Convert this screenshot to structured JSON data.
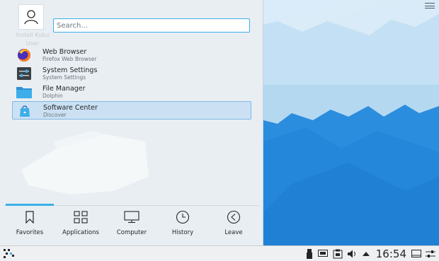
{
  "launcher": {
    "user": {
      "line1": "Install Kubu",
      "line2": "User"
    },
    "search": {
      "placeholder": "Search..."
    },
    "apps": [
      {
        "name": "Web Browser",
        "description": "Firefox Web Browser",
        "icon": "firefox-icon"
      },
      {
        "name": "System Settings",
        "description": "System Settings",
        "icon": "system-settings-icon"
      },
      {
        "name": "File Manager",
        "description": "Dolphin",
        "icon": "folder-icon"
      },
      {
        "name": "Software Center",
        "description": "Discover",
        "icon": "discover-icon",
        "selected": true
      }
    ],
    "tabs": [
      {
        "label": "Favorites",
        "icon": "bookmark-icon",
        "active": true
      },
      {
        "label": "Applications",
        "icon": "grid-icon"
      },
      {
        "label": "Computer",
        "icon": "monitor-icon"
      },
      {
        "label": "History",
        "icon": "clock-icon"
      },
      {
        "label": "Leave",
        "icon": "back-arrow-icon"
      }
    ]
  },
  "taskbar": {
    "clock": "16:54",
    "tray_icons": [
      "usb-icon",
      "network-icon",
      "clipboard-icon",
      "volume-icon",
      "expand-arrow-icon"
    ]
  },
  "colors": {
    "accent": "#3daee9",
    "selection": "#cbe1f3",
    "wallpaper_dark": "#1d7fd4",
    "wallpaper_light": "#cfe7f8"
  }
}
